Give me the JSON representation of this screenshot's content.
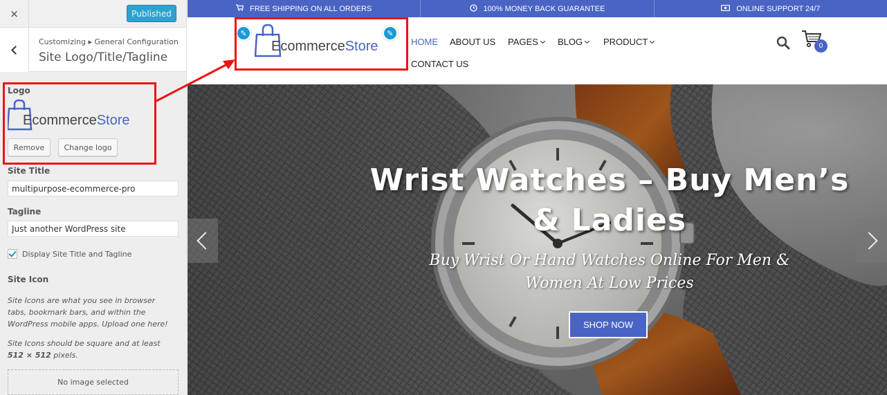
{
  "sidebar": {
    "close_icon": "×",
    "publish_label": "Published",
    "breadcrumb": "Customizing ▸ General Configuration",
    "section_title": "Site Logo/Title/Tagline",
    "logo_label": "Logo",
    "logo": {
      "text_dark": "Ecommerce",
      "text_accent": "Store"
    },
    "remove_label": "Remove",
    "change_logo_label": "Change logo",
    "site_title_label": "Site Title",
    "site_title_value": "multipurpose-ecommerce-pro",
    "tagline_label": "Tagline",
    "tagline_value": "Just another WordPress site",
    "display_title_label": "Display Site Title and Tagline",
    "display_title_checked": true,
    "site_icon_label": "Site Icon",
    "site_icon_desc": "Site Icons are what you see in browser tabs, bookmark bars, and within the WordPress mobile apps. Upload one here!",
    "site_icon_desc2_prefix": "Site Icons should be square and at least ",
    "site_icon_desc2_size": "512 × 512",
    "site_icon_desc2_suffix": " pixels.",
    "no_image_label": "No image selected"
  },
  "topbar": {
    "items": [
      {
        "icon": "cart-icon",
        "label": "FREE SHIPPING ON ALL ORDERS"
      },
      {
        "icon": "clock-icon",
        "label": "100% MONEY BACK GUARANTEE"
      },
      {
        "icon": "money-icon",
        "label": "ONLINE SUPPORT 24/7"
      }
    ]
  },
  "header": {
    "logo": {
      "text_dark": "Ecommerce",
      "text_accent": "Store"
    },
    "nav": {
      "home": "HOME",
      "about": "ABOUT US",
      "pages": "PAGES",
      "blog": "BLOG",
      "product": "PRODUCT",
      "contact": "CONTACT US"
    },
    "cart_count": "0"
  },
  "hero": {
    "title": "Wrist Watches – Buy Men’s & Ladies",
    "subtitle": "Buy Wrist Or Hand Watches Online For Men & Women At Low Prices",
    "button_label": "SHOP NOW"
  },
  "colors": {
    "brand": "#4a64c4",
    "highlight": "#ee1111",
    "customizer_blue": "#2ea2cc"
  }
}
